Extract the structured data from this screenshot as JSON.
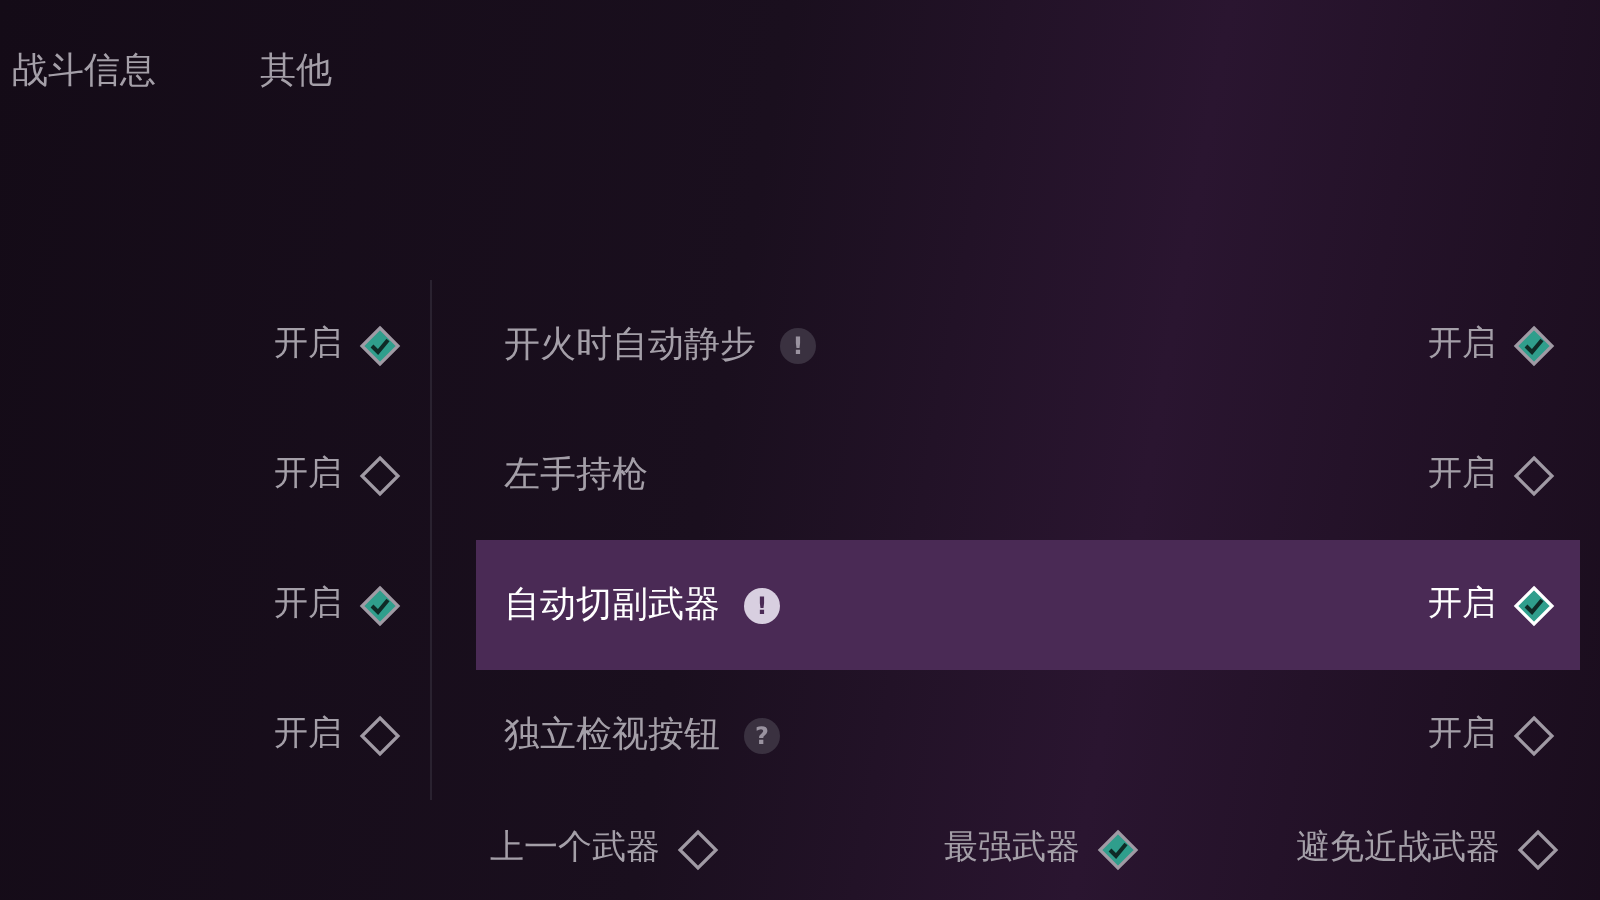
{
  "tabs": [
    {
      "label": "战斗信息",
      "selected": false
    },
    {
      "label": "其他",
      "selected": false
    }
  ],
  "left_column": [
    {
      "label": "开启",
      "checked": true
    },
    {
      "label": "开启",
      "checked": false
    },
    {
      "label": "开启",
      "checked": true
    },
    {
      "label": "开启",
      "checked": false
    }
  ],
  "settings": [
    {
      "label": "开火时自动静步",
      "hint": "!",
      "value": "开启",
      "checked": true,
      "selected": false
    },
    {
      "label": "左手持枪",
      "value": "开启",
      "checked": false,
      "selected": false
    },
    {
      "label": "自动切副武器",
      "hint": "!",
      "value": "开启",
      "checked": true,
      "selected": true
    },
    {
      "label": "独立检视按钮",
      "hint": "?",
      "value": "开启",
      "checked": false,
      "selected": false
    }
  ],
  "bottom_options": [
    {
      "label": "上一个武器",
      "checked": false
    },
    {
      "label": "最强武器",
      "checked": true
    },
    {
      "label": "避免近战武器",
      "checked": false
    }
  ]
}
